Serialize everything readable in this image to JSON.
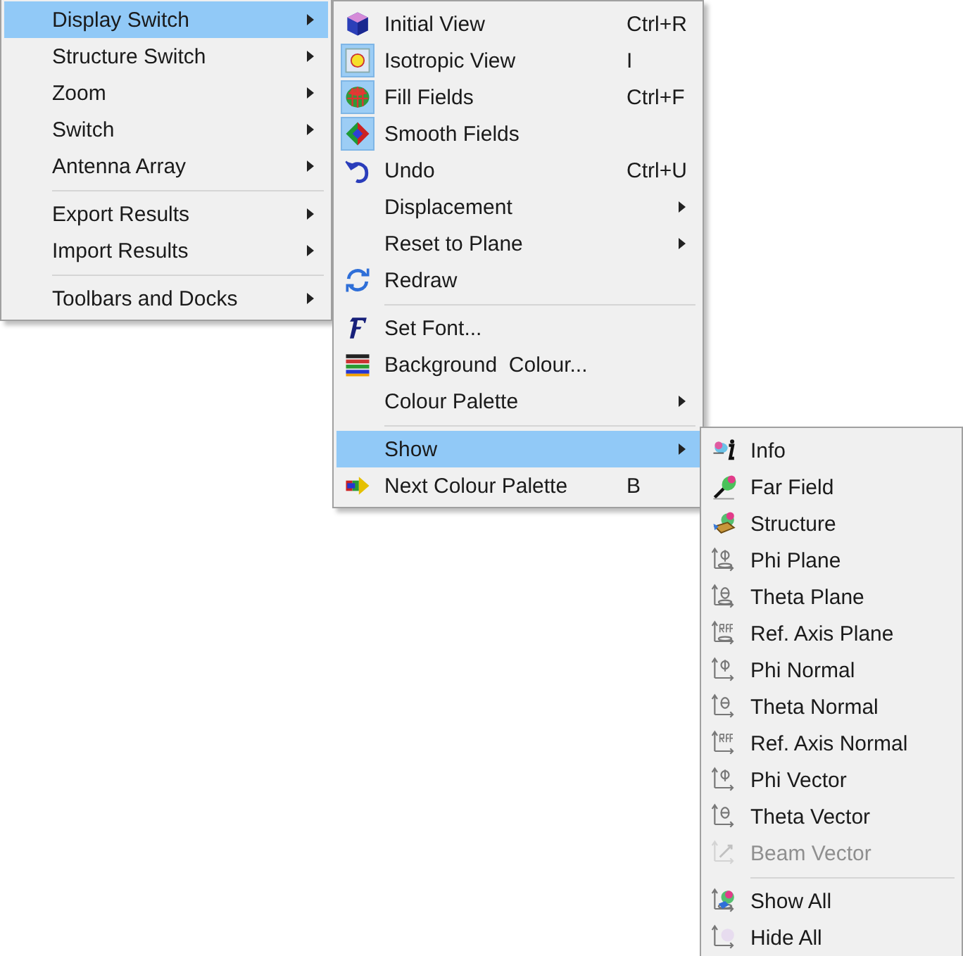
{
  "menus": [
    {
      "items": [
        {
          "kind": "item",
          "label": "Display Switch",
          "submenu": true,
          "selected": true
        },
        {
          "kind": "item",
          "label": "Structure Switch",
          "submenu": true,
          "selected": false
        },
        {
          "kind": "item",
          "label": "Zoom",
          "submenu": true,
          "selected": false
        },
        {
          "kind": "item",
          "label": "Switch",
          "submenu": true,
          "selected": false
        },
        {
          "kind": "item",
          "label": "Antenna Array",
          "submenu": true,
          "selected": false
        },
        {
          "kind": "separator"
        },
        {
          "kind": "item",
          "label": "Export Results",
          "submenu": true,
          "selected": false
        },
        {
          "kind": "item",
          "label": "Import Results",
          "submenu": true,
          "selected": false
        },
        {
          "kind": "separator"
        },
        {
          "kind": "item",
          "label": "Toolbars and Docks",
          "submenu": true,
          "selected": false
        }
      ]
    },
    {
      "items": [
        {
          "kind": "item",
          "label": "Initial View",
          "shortcut": "Ctrl+R",
          "checked": false,
          "selected": false
        },
        {
          "kind": "item",
          "label": "Isotropic View",
          "shortcut": "I",
          "checked": true,
          "selected": false
        },
        {
          "kind": "item",
          "label": "Fill Fields",
          "shortcut": "Ctrl+F",
          "checked": true,
          "selected": false
        },
        {
          "kind": "item",
          "label": "Smooth Fields",
          "checked": true,
          "selected": false
        },
        {
          "kind": "item",
          "label": "Undo",
          "shortcut": "Ctrl+U",
          "checked": false,
          "selected": false
        },
        {
          "kind": "item",
          "label": "Displacement",
          "submenu": true,
          "selected": false
        },
        {
          "kind": "item",
          "label": "Reset to Plane",
          "submenu": true,
          "selected": false
        },
        {
          "kind": "item",
          "label": "Redraw",
          "selected": false
        },
        {
          "kind": "separator"
        },
        {
          "kind": "item",
          "label": "Set Font...",
          "selected": false
        },
        {
          "kind": "item",
          "label": "Background  Colour...",
          "selected": false
        },
        {
          "kind": "item",
          "label": "Colour Palette",
          "submenu": true,
          "selected": false
        },
        {
          "kind": "separator"
        },
        {
          "kind": "item",
          "label": "Show",
          "submenu": true,
          "selected": true
        },
        {
          "kind": "item",
          "label": "Next Colour Palette",
          "shortcut": "B",
          "selected": false
        }
      ]
    },
    {
      "items": [
        {
          "kind": "item",
          "label": "Info",
          "disabled": false,
          "selected": false
        },
        {
          "kind": "item",
          "label": "Far Field",
          "disabled": false,
          "selected": false
        },
        {
          "kind": "item",
          "label": "Structure",
          "disabled": false,
          "selected": false
        },
        {
          "kind": "item",
          "label": "Phi Plane",
          "disabled": false,
          "selected": false
        },
        {
          "kind": "item",
          "label": "Theta Plane",
          "disabled": false,
          "selected": false
        },
        {
          "kind": "item",
          "label": "Ref. Axis Plane",
          "disabled": false,
          "selected": false
        },
        {
          "kind": "item",
          "label": "Phi Normal",
          "disabled": false,
          "selected": false
        },
        {
          "kind": "item",
          "label": "Theta Normal",
          "disabled": false,
          "selected": false
        },
        {
          "kind": "item",
          "label": "Ref. Axis Normal",
          "disabled": false,
          "selected": false
        },
        {
          "kind": "item",
          "label": "Phi Vector",
          "disabled": false,
          "selected": false
        },
        {
          "kind": "item",
          "label": "Theta Vector",
          "disabled": false,
          "selected": false
        },
        {
          "kind": "item",
          "label": "Beam Vector",
          "disabled": true,
          "selected": false
        },
        {
          "kind": "separator"
        },
        {
          "kind": "item",
          "label": "Show All",
          "disabled": false,
          "selected": false
        },
        {
          "kind": "item",
          "label": "Hide All",
          "disabled": false,
          "selected": false
        }
      ]
    }
  ]
}
